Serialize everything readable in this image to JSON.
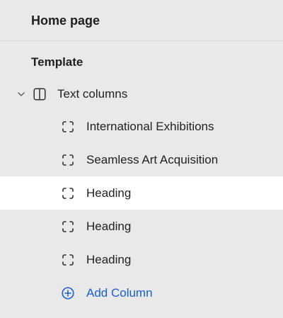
{
  "header": {
    "title": "Home page"
  },
  "sidebar": {
    "section_heading": "Template",
    "section": {
      "label": "Text columns",
      "icon": "columns-icon",
      "expanded": true
    },
    "blocks": [
      {
        "label": "International Exhibitions",
        "icon": "block-icon",
        "selected": false
      },
      {
        "label": "Seamless Art Acquisition",
        "icon": "block-icon",
        "selected": false
      },
      {
        "label": "Heading",
        "icon": "block-icon",
        "selected": true
      },
      {
        "label": "Heading",
        "icon": "block-icon",
        "selected": false
      },
      {
        "label": "Heading",
        "icon": "block-icon",
        "selected": false
      }
    ],
    "add_block": {
      "label": "Add Column",
      "icon": "plus-circle-icon"
    }
  },
  "colors": {
    "panel_background": "#e9e9e9",
    "selected_row_background": "#ffffff",
    "text": "#202223",
    "accent": "#1b5fd6"
  }
}
